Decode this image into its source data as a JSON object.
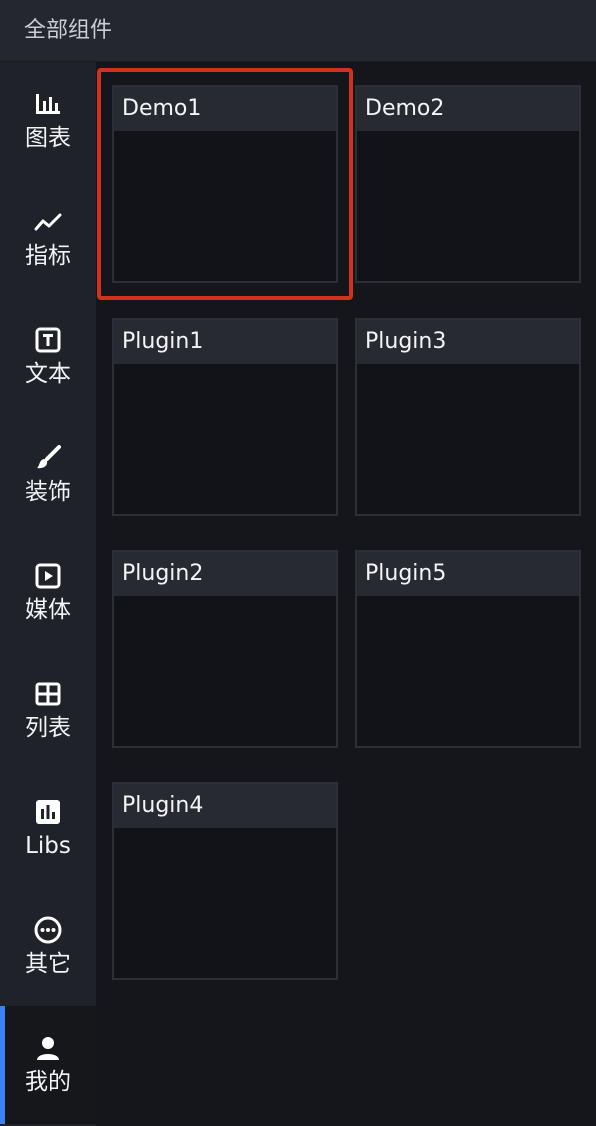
{
  "header": {
    "title": "全部组件"
  },
  "sidebar": {
    "items": [
      {
        "label": "图表",
        "icon": "bar-chart-icon"
      },
      {
        "label": "指标",
        "icon": "trend-line-icon"
      },
      {
        "label": "文本",
        "icon": "text-box-icon"
      },
      {
        "label": "装饰",
        "icon": "brush-icon"
      },
      {
        "label": "媒体",
        "icon": "play-box-icon"
      },
      {
        "label": "列表",
        "icon": "table-grid-icon"
      },
      {
        "label": "Libs",
        "icon": "chart-square-icon"
      },
      {
        "label": "其它",
        "icon": "more-circle-icon"
      },
      {
        "label": "我的",
        "icon": "user-icon"
      }
    ],
    "active_index": 8
  },
  "components": [
    {
      "title": "Demo1",
      "selected": true
    },
    {
      "title": "Demo2",
      "selected": false
    },
    {
      "title": "Plugin1",
      "selected": false
    },
    {
      "title": "Plugin3",
      "selected": false
    },
    {
      "title": "Plugin2",
      "selected": false
    },
    {
      "title": "Plugin5",
      "selected": false
    },
    {
      "title": "Plugin4",
      "selected": false
    }
  ],
  "colors": {
    "selection_border": "#d0321f",
    "active_indicator": "#3b82f6"
  }
}
